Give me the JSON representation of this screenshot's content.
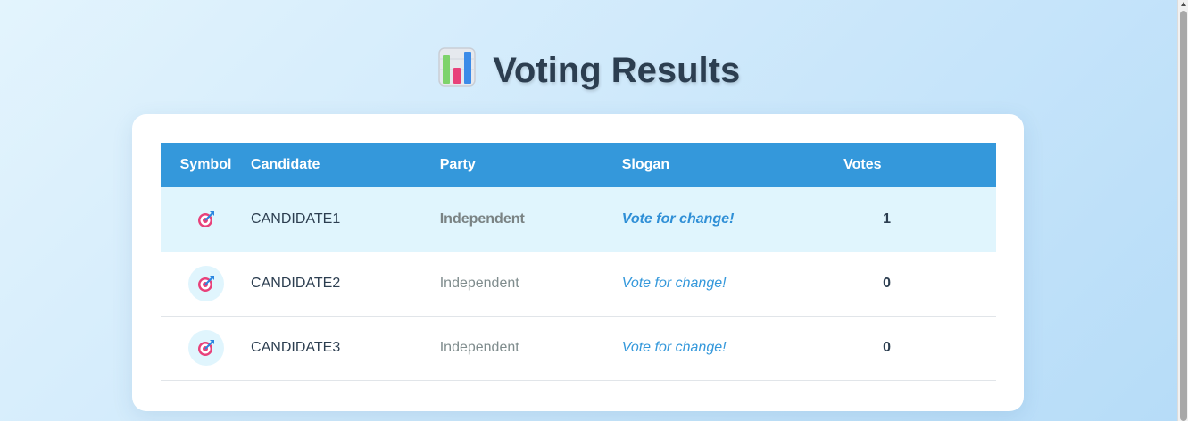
{
  "page": {
    "title": "Voting Results",
    "title_icon": "bar-chart-icon"
  },
  "colors": {
    "header_bg": "#3498db",
    "title_text": "#2c3e50",
    "highlight_row": "#e0f5fd",
    "slogan": "#3498db",
    "party": "#7f8c8d"
  },
  "table": {
    "headers": {
      "symbol": "Symbol",
      "candidate": "Candidate",
      "party": "Party",
      "slogan": "Slogan",
      "votes": "Votes"
    },
    "rows": [
      {
        "symbol_icon": "target-icon",
        "candidate": "CANDIDATE1",
        "party": "Independent",
        "slogan": "Vote for change!",
        "votes": "1",
        "highlighted": true
      },
      {
        "symbol_icon": "target-icon",
        "candidate": "CANDIDATE2",
        "party": "Independent",
        "slogan": "Vote for change!",
        "votes": "0",
        "highlighted": false
      },
      {
        "symbol_icon": "target-icon",
        "candidate": "CANDIDATE3",
        "party": "Independent",
        "slogan": "Vote for change!",
        "votes": "0",
        "highlighted": false
      }
    ]
  }
}
